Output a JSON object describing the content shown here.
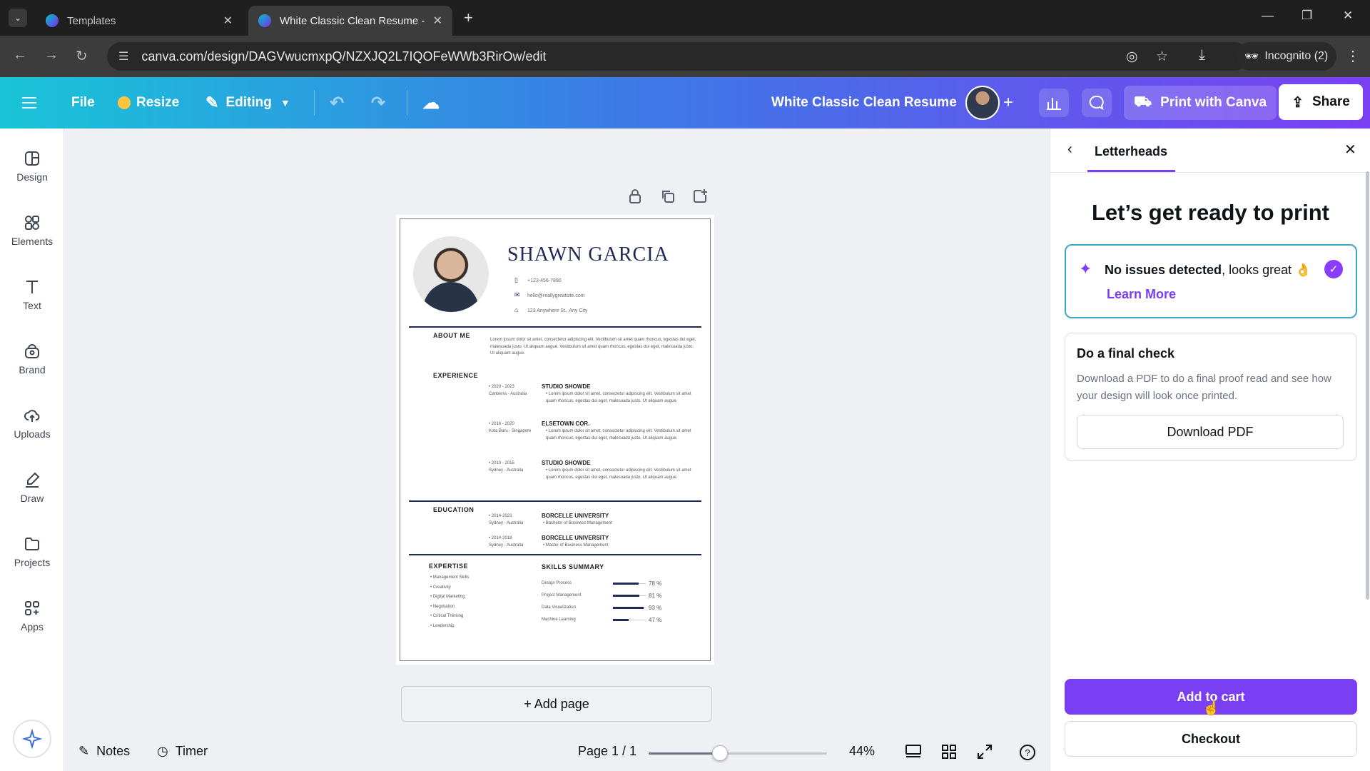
{
  "browser": {
    "tabs": [
      {
        "title": "Templates"
      },
      {
        "title": "White Classic Clean Resume - A"
      }
    ],
    "url": "canva.com/design/DAGVwucmxpQ/NZXJQ2L7IQOFeWWb3RirOw/edit",
    "incognito_label": "Incognito (2)"
  },
  "toolbar": {
    "file": "File",
    "resize": "Resize",
    "editing": "Editing",
    "doc_title": "White Classic Clean Resume",
    "print": "Print with Canva",
    "share": "Share"
  },
  "sidebar": {
    "items": [
      {
        "label": "Design"
      },
      {
        "label": "Elements"
      },
      {
        "label": "Text"
      },
      {
        "label": "Brand"
      },
      {
        "label": "Uploads"
      },
      {
        "label": "Draw"
      },
      {
        "label": "Projects"
      },
      {
        "label": "Apps"
      }
    ]
  },
  "resume": {
    "name": "SHAWN GARCIA",
    "phone": "+123-456-7890",
    "email": "hello@reallygreatsite.com",
    "address": "123 Anywhere St., Any City",
    "about_heading": "ABOUT ME",
    "about_text": "Lorem ipsum dolor sit amet, consectetur adipiscing elit. Vestibulum sit amet quam rhoncus, egestas dui eget, malesuada justo. Ut aliquam augue. Vestibulum sit amet quam rhoncus, egestas dui eget, malesuada justo. Ut aliquam augue.",
    "experience_heading": "EXPERIENCE",
    "experience": [
      {
        "years": "2020 - 2023",
        "place": "Canberra - Australia",
        "company": "STUDIO SHOWDE",
        "text": "Lorem ipsum dolor sit amet, consectetur adipiscing elit. Vestibulum sit amet quam rhoncus, egestas dui eget, malesuada justo. Ut aliquam augue."
      },
      {
        "years": "2016 - 2020",
        "place": "Kota Baru - Singapore",
        "company": "ELSETOWN COR.",
        "text": "Lorem ipsum dolor sit amet, consectetur adipiscing elit. Vestibulum sit amet quam rhoncus, egestas dui eget, malesuada justo. Ut aliquam augue."
      },
      {
        "years": "2010 - 2015",
        "place": "Sydney - Australia",
        "company": "STUDIO SHOWDE",
        "text": "Lorem ipsum dolor sit amet, consectetur adipiscing elit. Vestibulum sit amet quam rhoncus, egestas dui eget, malesuada justo. Ut aliquam augue."
      }
    ],
    "education_heading": "EDUCATION",
    "education": [
      {
        "years": "2014-2023",
        "place": "Sydney - Australia",
        "school": "BORCELLE UNIVERSITY",
        "degree": "Bachelor of Business Management"
      },
      {
        "years": "2014-2018",
        "place": "Sydney - Australia",
        "school": "BORCELLE UNIVERSITY",
        "degree": "Master of Business Management"
      }
    ],
    "expertise_heading": "EXPERTISE",
    "expertise": [
      "Management Skills",
      "Creativity",
      "Digital Marketing",
      "Negotiation",
      "Critical Thinking",
      "Leadership"
    ],
    "skills_heading": "SKILLS SUMMARY",
    "skills": [
      {
        "name": "Design Process",
        "value": 78,
        "label": "78 %"
      },
      {
        "name": "Project Management",
        "value": 81,
        "label": "81 %"
      },
      {
        "name": "Data Visualization",
        "value": 93,
        "label": "93 %"
      },
      {
        "name": "Machine Learning",
        "value": 47,
        "label": "47 %"
      }
    ]
  },
  "canvas": {
    "add_page": "+ Add page",
    "notes": "Notes",
    "timer": "Timer",
    "page_indicator": "Page 1 / 1",
    "zoom": "44%",
    "zoom_fraction": 0.4
  },
  "panel": {
    "tab": "Letterheads",
    "title": "Let’s get ready to print",
    "status_bold": "No issues detected",
    "status_rest": ", looks great",
    "learn_more": "Learn More",
    "final_check_title": "Do a final check",
    "final_check_text": "Download a PDF to do a final proof read and see how your design will look once printed.",
    "download_pdf": "Download PDF",
    "add_to_cart": "Add to cart",
    "checkout": "Checkout"
  },
  "colors": {
    "accent": "#7a3ff2",
    "resume_navy": "#1e2a55",
    "check_purple": "#8b3dff"
  }
}
